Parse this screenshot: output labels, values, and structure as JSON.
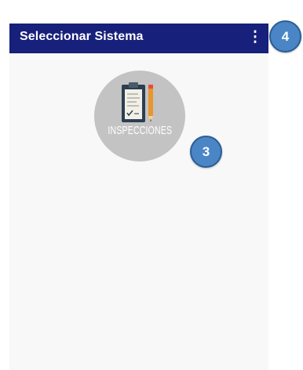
{
  "appbar": {
    "title": "Seleccionar Sistema",
    "menu_icon": "more-vert-icon",
    "menu_glyph": "⋮",
    "background_color": "#17207a"
  },
  "systems": [
    {
      "label": "INSPECCIONES",
      "icon": "clipboard-pencil-icon"
    }
  ],
  "annotations": [
    {
      "number": "4"
    },
    {
      "number": "3"
    }
  ],
  "colors": {
    "tile": "#c3c3c3",
    "badge": "#4a86c6",
    "screen_background": "#f8f8f8"
  }
}
